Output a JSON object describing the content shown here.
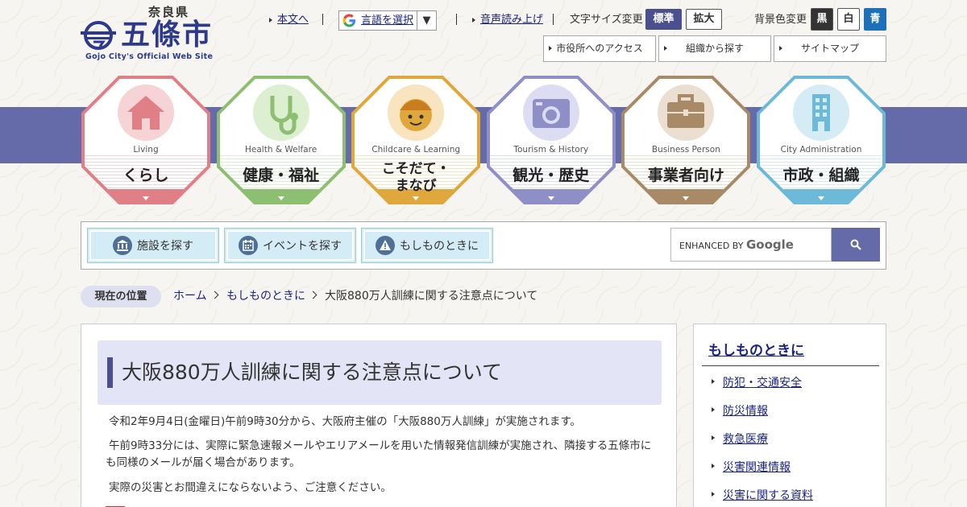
{
  "header": {
    "logo": {
      "pref": "奈良県",
      "city": "五條市",
      "en": "Gojo City's Official Web Site"
    },
    "skip_link": "本文へ",
    "language": {
      "label": "言語を選択",
      "arrow": "▼"
    },
    "read_aloud": "音声読み上げ",
    "font_size": {
      "label": "文字サイズ変更",
      "standard": "標準",
      "large": "拡大"
    },
    "bg_color": {
      "label": "背景色変更",
      "black": "黒",
      "white": "白",
      "blue": "青"
    },
    "sub_nav": [
      "市役所へのアクセス",
      "組織から探す",
      "サイトマップ"
    ]
  },
  "categories": [
    {
      "en": "Living",
      "jp": "くらし",
      "color": "#e07f86",
      "fill": "#f6d3d5",
      "icon": "house-icon"
    },
    {
      "en": "Health & Welfare",
      "jp": "健康・福祉",
      "color": "#8cbf72",
      "fill": "#dcefd0",
      "icon": "stethoscope-icon"
    },
    {
      "en": "Childcare & Learning",
      "jp": "こそだて・\nまなび",
      "color": "#e0a83c",
      "fill": "#f8e4bf",
      "icon": "child-icon"
    },
    {
      "en": "Tourism & History",
      "jp": "観光・歴史",
      "color": "#8d8fc6",
      "fill": "#dcddf2",
      "icon": "camera-icon"
    },
    {
      "en": "Business Person",
      "jp": "事業者向け",
      "color": "#a88a67",
      "fill": "#eadfd0",
      "icon": "briefcase-icon"
    },
    {
      "en": "City Administration",
      "jp": "市政・組織",
      "color": "#6db9d8",
      "fill": "#d6ecf5",
      "icon": "building-icon"
    }
  ],
  "toolbar": {
    "facility": "施設を探す",
    "event": "イベントを探す",
    "emergency": "もしものときに",
    "search_prefix": "ENHANCED BY",
    "search_brand": "Google"
  },
  "breadcrumb": {
    "label": "現在の位置",
    "home": "ホーム",
    "parent": "もしものときに",
    "current": "大阪880万人訓練に関する注意点について"
  },
  "article": {
    "title": "大阪880万人訓練に関する注意点について",
    "p1": "令和2年9月4日(金曜日)午前9時30分から、大阪府主催の「大阪880万人訓練」が実施されます。",
    "p2": "午前9時33分には、実際に緊急速報メールやエリアメールを用いた情報発信訓練が実施され、隣接する五條市にも同様のメールが届く場合があります。",
    "p3": "実際の災害とお間違えにならないよう、ご注意ください。"
  },
  "side": {
    "title": "もしものときに",
    "items": [
      "防犯・交通安全",
      "防災情報",
      "救急医療",
      "災害関連情報",
      "災害に関する資料"
    ]
  },
  "colors": {
    "accent": "#656aa8",
    "standard_btn": "#4a4f8e",
    "bg_black": "#333333",
    "bg_blue": "#1d6fb8"
  }
}
